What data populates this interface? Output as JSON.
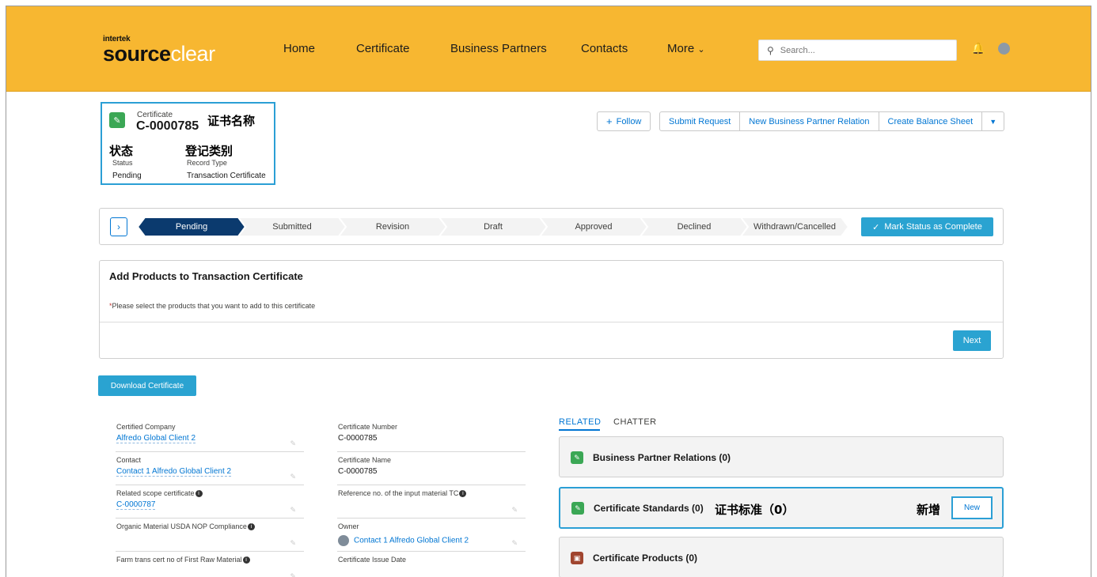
{
  "brand": {
    "small": "intertek",
    "main_dark": "source",
    "main_light": "clear"
  },
  "nav": {
    "home": "Home",
    "certificate": "Certificate",
    "business_partners": "Business Partners",
    "contacts": "Contacts",
    "more": "More"
  },
  "search": {
    "placeholder": "Search..."
  },
  "record": {
    "object_label": "Certificate",
    "number": "C-0000785",
    "annotation_name": "证书名称",
    "annotation_status": "状态",
    "annotation_record_type": "登记类别",
    "status_label": "Status",
    "status_value": "Pending",
    "record_type_label": "Record Type",
    "record_type_value": "Transaction Certificate"
  },
  "actions": {
    "follow": "Follow",
    "submit_request": "Submit Request",
    "new_bp_relation": "New Business Partner Relation",
    "create_balance_sheet": "Create Balance Sheet"
  },
  "path": {
    "stages": [
      "Pending",
      "Submitted",
      "Revision",
      "Draft",
      "Approved",
      "Declined",
      "Withdrawn/Cancelled"
    ],
    "active_index": 0,
    "mark_complete": "Mark Status as Complete"
  },
  "add_products": {
    "title": "Add Products to Transaction Certificate",
    "note_req": "*",
    "note": "Please select the products that you want to add to this certificate",
    "next": "Next"
  },
  "download_button": "Download Certificate",
  "details": {
    "certified_company": {
      "label": "Certified Company",
      "value": "Alfredo Global Client 2"
    },
    "contact": {
      "label": "Contact",
      "value": "Contact 1 Alfredo Global Client 2"
    },
    "related_scope": {
      "label": "Related scope certificate",
      "value": "C-0000787"
    },
    "organic_usda": {
      "label": "Organic Material USDA NOP Compliance",
      "value": ""
    },
    "farm_trans": {
      "label": "Farm trans cert no of First Raw Material",
      "value": ""
    },
    "cert_number": {
      "label": "Certificate Number",
      "value": "C-0000785"
    },
    "cert_name": {
      "label": "Certificate Name",
      "value": "C-0000785"
    },
    "reference_no": {
      "label": "Reference no. of the input material TC",
      "value": ""
    },
    "owner": {
      "label": "Owner",
      "value": "Contact 1 Alfredo Global Client 2"
    },
    "issue_date": {
      "label": "Certificate Issue Date",
      "value": ""
    }
  },
  "related": {
    "tab_related": "RELATED",
    "tab_chatter": "CHATTER",
    "lists": {
      "bp_relations": "Business Partner Relations (0)",
      "standards": "Certificate Standards (0)",
      "standards_annotation": "证书标准（0）",
      "new_annotation": "新增",
      "new_button": "New",
      "products": "Certificate Products (0)"
    }
  },
  "colors": {
    "header": "#f7b731",
    "accent": "#2aa3d1",
    "path_active": "#0b3a6e",
    "highlight": "#2b9fd5"
  }
}
